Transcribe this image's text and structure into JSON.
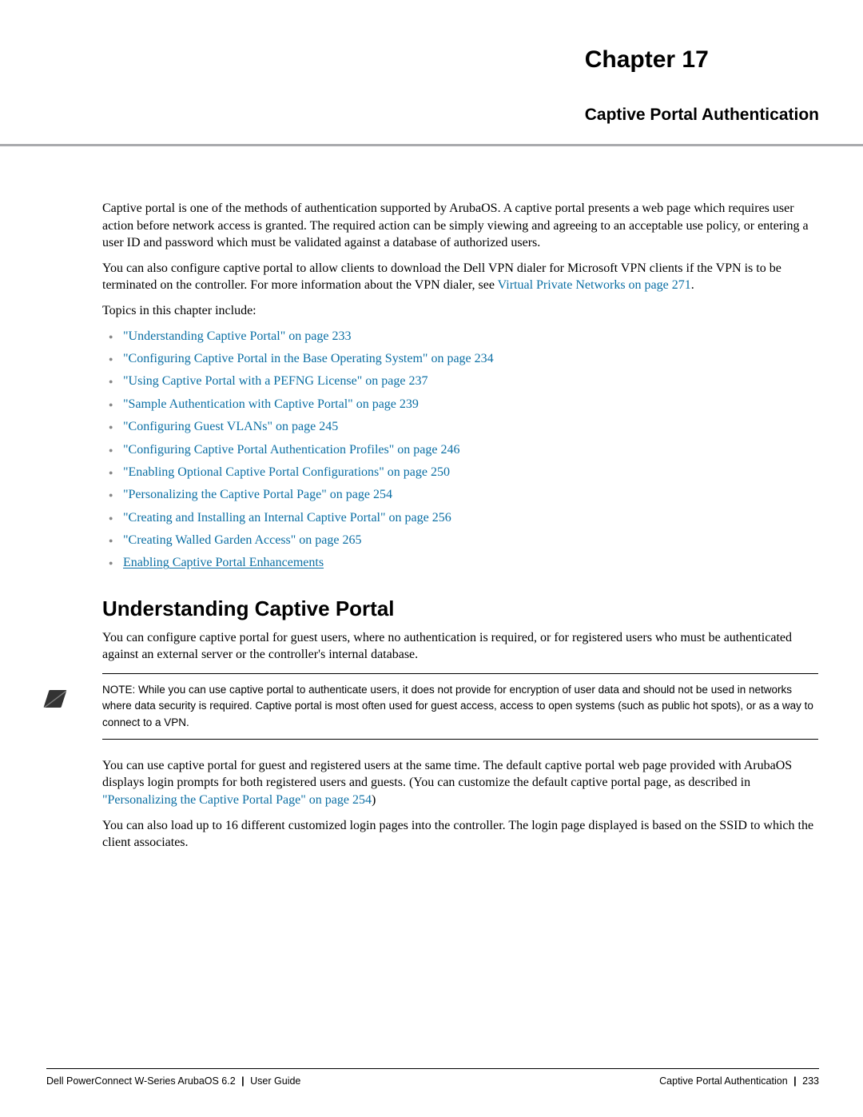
{
  "header": {
    "chapter": "Chapter 17",
    "subtitle": "Captive Portal Authentication"
  },
  "intro": {
    "p1": "Captive portal is one of the methods of authentication supported by ArubaOS. A captive portal presents a web page which requires user action before network access is granted. The required action can be simply viewing and agreeing to an acceptable use policy, or entering a user ID and password which must be validated against a database of authorized users.",
    "p2_a": "You can also configure captive portal to allow clients to download the Dell VPN dialer for Microsoft VPN clients if the VPN is to be terminated on the controller. For more information about the VPN dialer, see ",
    "p2_link": "Virtual Private Networks on page 271",
    "p2_b": ".",
    "p3": "Topics in this chapter include:"
  },
  "topics": [
    "\"Understanding Captive Portal\" on page 233",
    "\"Configuring Captive Portal in the Base Operating System\" on page 234",
    "\"Using Captive Portal with a PEFNG License\" on page 237",
    "\"Sample Authentication with Captive Portal\" on page 239",
    "\"Configuring Guest VLANs\" on page 245",
    "\"Configuring Captive Portal Authentication Profiles\" on page 246",
    "\"Enabling Optional Captive Portal Configurations\" on page 250",
    "\"Personalizing the Captive Portal Page\" on page 254",
    "\"Creating and Installing an Internal Captive Portal\" on page 256",
    "\"Creating Walled Garden Access\" on page 265"
  ],
  "last_topic": "Enabling Captive Portal Enhancements",
  "section": {
    "heading": "Understanding Captive Portal",
    "p1": "You can configure captive portal for guest users, where no authentication is required, or for registered users who must be authenticated against an external server or the controller's internal database.",
    "note": "NOTE: While you can use captive portal to authenticate users, it does not provide for encryption of user data and should not be used in networks where data security is required. Captive portal is most often used for guest access, access to open systems (such as public hot spots), or as a way to connect to a VPN.",
    "p2_a": "You can use captive portal for guest and registered users at the same time. The default captive portal web page provided with ArubaOS displays login prompts for both registered users and guests. (You can customize the default captive portal page, as described in ",
    "p2_link": "\"Personalizing the Captive Portal Page\" on page 254",
    "p2_b": ")",
    "p3": "You can also load up to 16 different customized login pages into the controller. The login page displayed is based on the SSID to which the client associates."
  },
  "footer": {
    "left_a": "Dell PowerConnect W-Series ArubaOS 6.2",
    "left_b": "User Guide",
    "right_a": "Captive Portal Authentication",
    "right_b": "233"
  }
}
